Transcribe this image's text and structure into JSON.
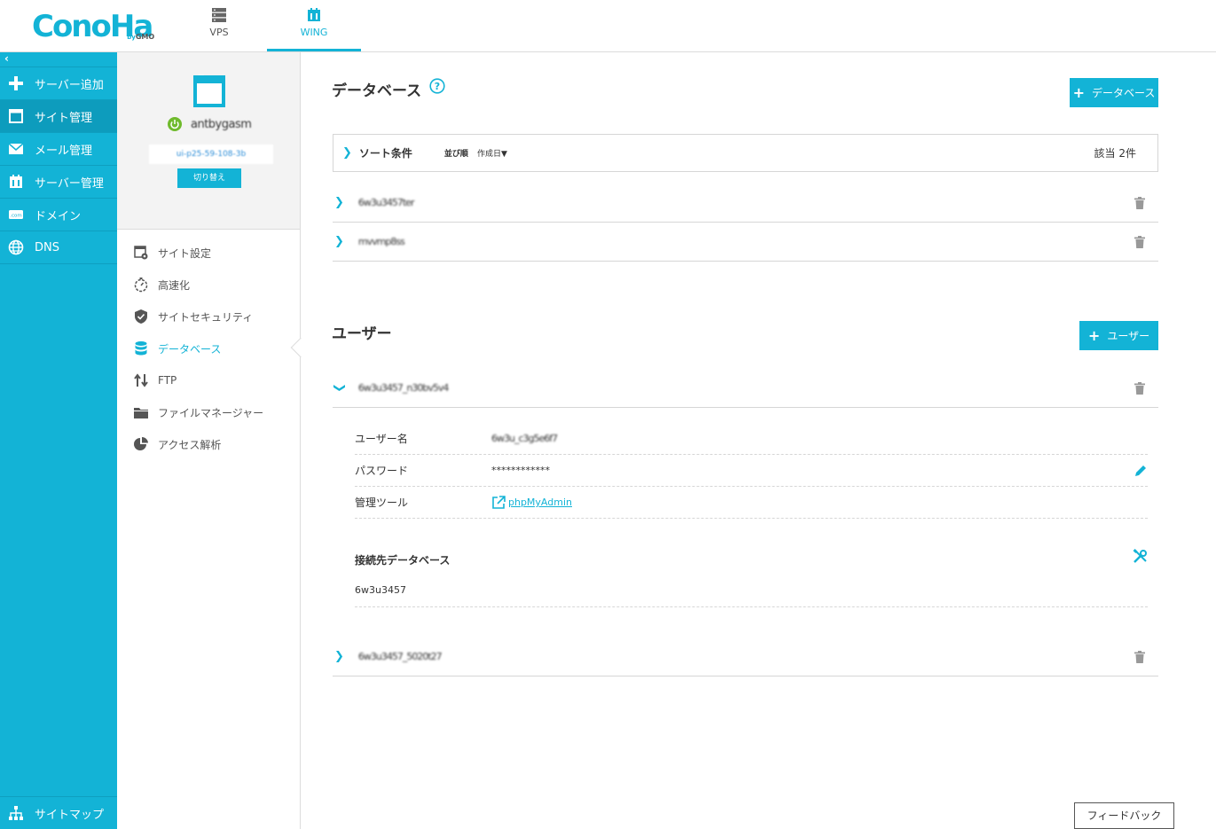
{
  "header": {
    "logo": "ConoHa",
    "logo_by": "by",
    "logo_gmo": "GMO",
    "tabs": [
      {
        "label": "VPS",
        "icon": "server-icon"
      },
      {
        "label": "WING",
        "icon": "wing-icon"
      }
    ]
  },
  "sidebar": {
    "collapse": "‹",
    "items": [
      {
        "label": "サーバー追加",
        "icon": "plus-icon"
      },
      {
        "label": "サイト管理",
        "icon": "window-icon"
      },
      {
        "label": "メール管理",
        "icon": "mail-icon"
      },
      {
        "label": "サーバー管理",
        "icon": "server-manage-icon"
      },
      {
        "label": "ドメイン",
        "icon": "domain-icon"
      },
      {
        "label": "DNS",
        "icon": "globe-icon"
      }
    ],
    "sitemap": "サイトマップ"
  },
  "site": {
    "name": "antbygasm",
    "url": "ui-p25-59-108-3b",
    "switch_label": "切り替え"
  },
  "submenu": [
    {
      "label": "サイト設定",
      "icon": "site-settings-icon"
    },
    {
      "label": "高速化",
      "icon": "stopwatch-icon"
    },
    {
      "label": "サイトセキュリティ",
      "icon": "shield-icon"
    },
    {
      "label": "データベース",
      "icon": "database-icon"
    },
    {
      "label": "FTP",
      "icon": "transfer-icon"
    },
    {
      "label": "ファイルマネージャー",
      "icon": "folder-icon"
    },
    {
      "label": "アクセス解析",
      "icon": "pie-chart-icon"
    }
  ],
  "database": {
    "title": "データベース",
    "add_label": "データベース",
    "sort_label": "ソート条件",
    "order_label": "並び順",
    "order_value": "作成日▼",
    "count": "該当 2件",
    "rows": [
      "6w3u3457ter",
      "mvvmp8ss"
    ]
  },
  "users": {
    "title": "ユーザー",
    "add_label": "ユーザー",
    "rows": [
      "6w3u3457_n30bv5v4",
      "6w3u3457_5020t27"
    ],
    "detail": {
      "username_label": "ユーザー名",
      "username_value": "6w3u_c3g5e6f7",
      "password_label": "パスワード",
      "password_value": "************",
      "tool_label": "管理ツール",
      "tool_value": "phpMyAdmin",
      "connected_db_label": "接続先データベース",
      "connected_db_value": "6w3u3457"
    }
  },
  "feedback": "フィードバック",
  "colors": {
    "accent": "#13b3d6",
    "power": "#6fba2c"
  }
}
